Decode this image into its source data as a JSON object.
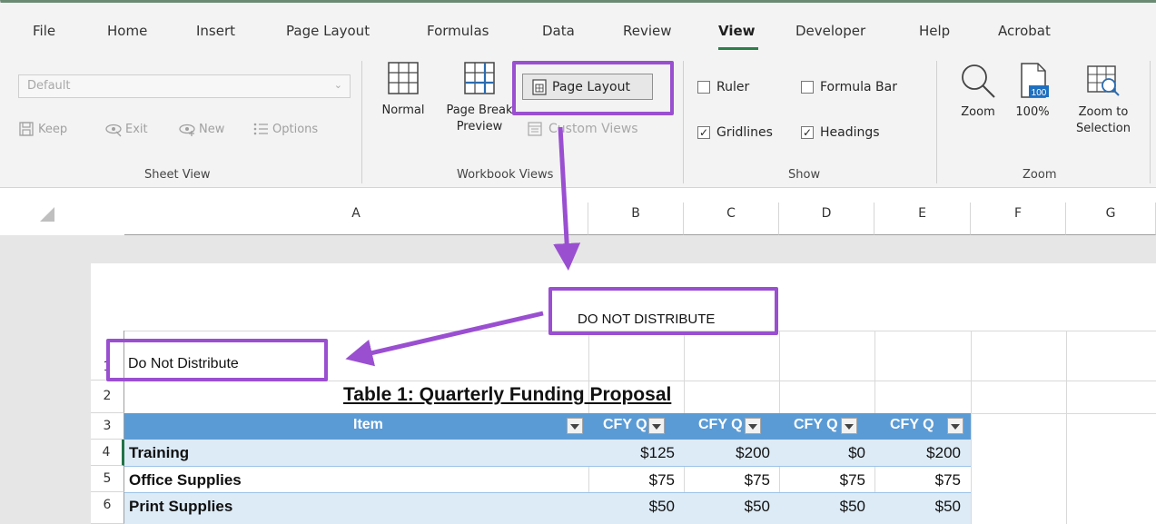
{
  "menu": {
    "tabs": [
      "File",
      "Home",
      "Insert",
      "Page Layout",
      "Formulas",
      "Data",
      "Review",
      "View",
      "Developer",
      "Help",
      "Acrobat"
    ],
    "active_tab": "View"
  },
  "ribbon": {
    "sheet_view": {
      "dropdown_value": "Default",
      "keep": "Keep",
      "exit": "Exit",
      "new": "New",
      "options": "Options",
      "group_label": "Sheet View"
    },
    "workbook_views": {
      "normal": "Normal",
      "page_break_line1": "Page Break",
      "page_break_line2": "Preview",
      "page_layout": "Page Layout",
      "custom_views": "Custom Views",
      "group_label": "Workbook Views"
    },
    "show": {
      "ruler": "Ruler",
      "ruler_checked": false,
      "formula_bar": "Formula Bar",
      "formula_bar_checked": false,
      "gridlines": "Gridlines",
      "gridlines_checked": true,
      "headings": "Headings",
      "headings_checked": true,
      "group_label": "Show"
    },
    "zoom": {
      "zoom": "Zoom",
      "hundred": "100%",
      "hundred_icon_text": "100",
      "zoom_to_line1": "Zoom to",
      "zoom_to_line2": "Selection",
      "group_label": "Zoom"
    }
  },
  "columns": [
    "A",
    "B",
    "C",
    "D",
    "E",
    "F",
    "G"
  ],
  "rows": [
    "1",
    "2",
    "3",
    "4",
    "5",
    "6"
  ],
  "page_header_text": "DO NOT DISTRIBUTE",
  "cell_a1": "Do Not Distribute",
  "table": {
    "title": "Table 1:  Quarterly Funding Proposal",
    "headers": [
      "Item",
      "CFY Q",
      "CFY Q",
      "CFY Q",
      "CFY Q"
    ],
    "rows": [
      {
        "item": "Training",
        "values": [
          "$125",
          "$200",
          "$0",
          "$200"
        ]
      },
      {
        "item": "Office Supplies",
        "values": [
          "$75",
          "$75",
          "$75",
          "$75"
        ]
      },
      {
        "item": "Print Supplies",
        "values": [
          "$50",
          "$50",
          "$50",
          "$50"
        ]
      }
    ]
  },
  "colors": {
    "annotation": "#9a4fd1",
    "table_header": "#5b9bd5",
    "table_band": "#ddebf7",
    "active_tab_underline": "#2e7d4a"
  }
}
